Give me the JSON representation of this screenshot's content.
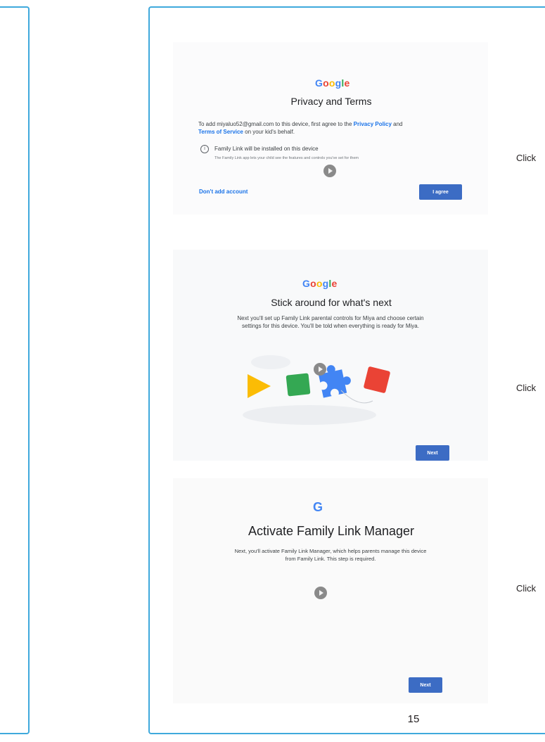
{
  "screen1": {
    "brand": "Google",
    "title": "Privacy and Terms",
    "body_pre": "To add miyaluo52@gmail.com to this device, first agree to the ",
    "privacy_link": "Privacy Policy",
    "body_and": " and",
    "terms_link": "Terms of Service",
    "body_post": " on your kid's behalf.",
    "info_title": "Family Link will be installed on this device",
    "info_sub": "The Family Link app lets your child see the features and controls you've set for them",
    "dont_add": "Don't add account",
    "agree_button": "I agree"
  },
  "screen2": {
    "brand": "Google",
    "title": "Stick around for what's next",
    "body_line1": "Next you'll set up Family Link parental controls for Miya and choose certain",
    "body_line2": "settings for this device. You'll be told when everything is ready for Miya.",
    "next_button": "Next"
  },
  "screen3": {
    "logo_letter": "G",
    "title": "Activate Family Link Manager",
    "body_line1": "Next, you'll activate Family Link Manager, which helps parents manage this device",
    "body_line2": "from Family Link. This step is required.",
    "next_button": "Next"
  },
  "annotations": {
    "click_1": "Click",
    "click_2": "Click",
    "click_3": "Click"
  },
  "page_number": "15",
  "colors": {
    "frame": "#3fa9dc",
    "button": "#3c6cc4",
    "link": "#1a73e8"
  }
}
